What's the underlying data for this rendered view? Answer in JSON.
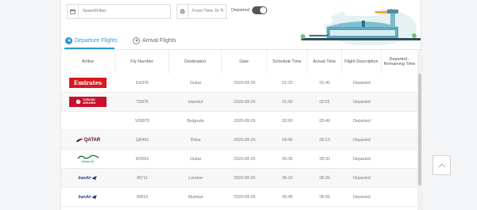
{
  "filters": {
    "search_placeholder": "SearchFilter",
    "from_time_placeholder": "From Time To Ti",
    "departed_toggle_label": "Departed",
    "search_icon": "calendar-icon",
    "time_icon": "gear-icon"
  },
  "tabs": [
    {
      "label": "Departure Flights",
      "active": true,
      "icon": "plane-up-icon"
    },
    {
      "label": "Arrival Flights",
      "active": false,
      "icon": "plane-down-icon"
    }
  ],
  "table": {
    "headers": [
      "Airline",
      "Fly Number",
      "Destination",
      "Date",
      "Schedule Time",
      "Actual Time",
      "Flight Description",
      "Departed - Remaining Time"
    ],
    "rows": [
      {
        "airline": "Emirates",
        "fly_number": "EK976",
        "destination": "Dubai",
        "date": "2020-09-29",
        "schedule": "01:25",
        "actual": "01:40",
        "description": "Departed"
      },
      {
        "airline": "TURKISH AIRLINES",
        "fly_number": "TK875",
        "destination": "Istanbul",
        "date": "2020-09-29",
        "schedule": "01:50",
        "actual": "02:01",
        "description": "Departed"
      },
      {
        "airline": "",
        "fly_number": "V09875",
        "destination": "Belgrade",
        "date": "2020-09-29",
        "schedule": "02:00",
        "actual": "03:49",
        "description": "Departed"
      },
      {
        "airline": "QATAR",
        "fly_number": "QR491",
        "destination": "Doha",
        "date": "2020-09-29",
        "schedule": "04:40",
        "actual": "05:13",
        "description": "Departed"
      },
      {
        "airline": "Mahan Air",
        "fly_number": "W5061",
        "destination": "Dubai",
        "date": "2020-09-29",
        "schedule": "05:30",
        "actual": "05:33",
        "description": "Departed"
      },
      {
        "airline": "IranAir",
        "fly_number": "IR711",
        "destination": "London",
        "date": "2020-09-29",
        "schedule": "06:10",
        "actual": "06:25",
        "description": "Departed"
      },
      {
        "airline": "IranAir",
        "fly_number": "IR810",
        "destination": "Mumbai",
        "date": "2020-09-29",
        "schedule": "06:45",
        "actual": "06:55",
        "description": "Departed"
      }
    ]
  },
  "colors": {
    "accent": "#2c98d8",
    "emirates_red": "#d71a21",
    "turkish_red": "#c8102e",
    "qatar_maroon": "#5c0632",
    "mahan_green": "#1e7a3c",
    "iranair_navy": "#1d3c78"
  },
  "back_to_top_icon": "chevron-up-icon"
}
